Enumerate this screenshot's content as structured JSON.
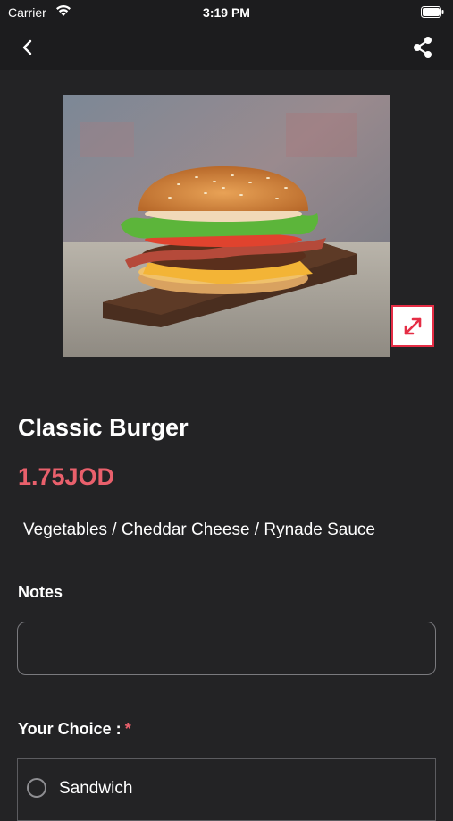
{
  "status_bar": {
    "carrier": "Carrier",
    "time": "3:19 PM"
  },
  "nav": {
    "back_icon": "chevron-left-icon",
    "share_icon": "share-icon"
  },
  "product": {
    "image_alt": "burger-photo",
    "name": "Classic Burger",
    "price": "1.75JOD",
    "description": "Vegetables / Cheddar Cheese / Rynade Sauce",
    "expand_icon": "expand-icon"
  },
  "notes": {
    "label": "Notes",
    "value": "",
    "placeholder": ""
  },
  "choice": {
    "label": "Your Choice :",
    "required_mark": "*",
    "options": [
      {
        "label": "Sandwich",
        "selected": false
      }
    ]
  },
  "colors": {
    "background": "#232325",
    "bar_background": "#1c1c1e",
    "price": "#e9606c",
    "accent": "#e52d45"
  }
}
